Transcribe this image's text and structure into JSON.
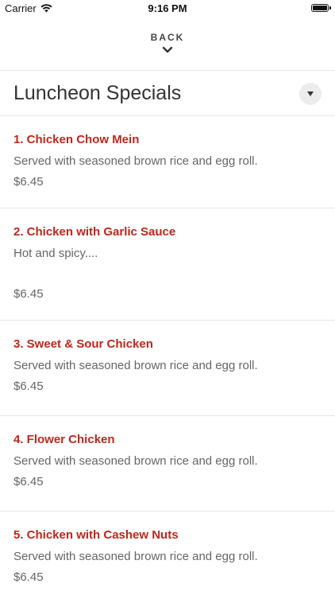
{
  "status_bar": {
    "carrier": "Carrier",
    "time": "9:16 PM"
  },
  "nav": {
    "back_label": "BACK"
  },
  "category": {
    "title": "Luncheon Specials"
  },
  "menu_items": [
    {
      "name": "1. Chicken Chow Mein",
      "description": "Served with seasoned brown rice and egg roll.",
      "price": "$6.45"
    },
    {
      "name": "2. Chicken with Garlic Sauce",
      "description": "Hot and spicy....",
      "price": "$6.45"
    },
    {
      "name": "3. Sweet & Sour Chicken",
      "description": "Served with seasoned brown rice and egg roll.",
      "price": "$6.45"
    },
    {
      "name": "4. Flower Chicken",
      "description": "Served with seasoned brown rice and egg roll.",
      "price": "$6.45"
    },
    {
      "name": "5. Chicken with Cashew Nuts",
      "description": "Served with seasoned brown rice and egg roll.",
      "price": "$6.45"
    }
  ],
  "colors": {
    "accent": "#c0261b",
    "text_primary": "#333333",
    "text_secondary": "#666666",
    "divider": "#e6e6e6"
  },
  "icons": {
    "wifi": "wifi-icon",
    "battery": "battery-icon",
    "back": "chevron-down-icon",
    "dropdown": "triangle-down-icon"
  }
}
